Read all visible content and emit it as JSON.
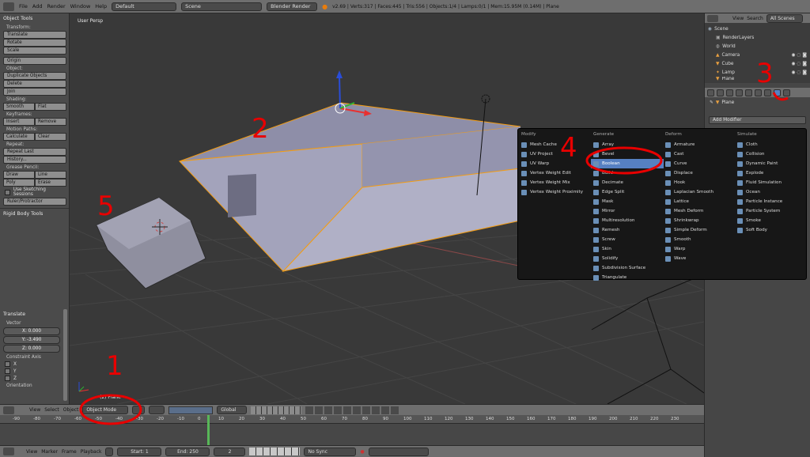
{
  "topbar": {
    "menus": [
      "File",
      "Add",
      "Render",
      "Window",
      "Help"
    ],
    "layout": "Default",
    "scene": "Scene",
    "engine": "Blender Render",
    "stats": "v2.69 | Verts:317 | Faces:445 | Tris:556 | Objects:1/4 | Lamps:0/1 | Mem:15.95M (0.14M) | Plane"
  },
  "left": {
    "title": "Object Tools",
    "transform_hdr": "Transform:",
    "transform": [
      "Translate",
      "Rotate",
      "Scale"
    ],
    "origin": "Origin",
    "object_hdr": "Object:",
    "object": [
      "Duplicate Objects",
      "Delete",
      "Join"
    ],
    "shading_hdr": "Shading:",
    "shading": [
      "Smooth",
      "Flat"
    ],
    "keyframes_hdr": "Keyframes:",
    "keyframes": [
      "Insert",
      "Remove"
    ],
    "motion_hdr": "Motion Paths:",
    "motion": [
      "Calculate",
      "Clear"
    ],
    "repeat_hdr": "Repeat:",
    "repeat": [
      "Repeat Last",
      "History..."
    ],
    "grease_hdr": "Grease Pencil:",
    "grease1": [
      "Draw",
      "Line"
    ],
    "grease2": [
      "Poly",
      "Erase"
    ],
    "sketch": "Use Sketching Sessions",
    "ruler": "Ruler/Protractor",
    "rigid": "Rigid Body Tools",
    "op_title": "Translate",
    "vector": "Vector",
    "x": "X: 0.000",
    "y": "Y: -3.490",
    "z": "Z: 0.000",
    "constraint": "Constraint Axis",
    "cx": "X",
    "cy": "Y",
    "cz": "Z",
    "orientation": "Orientation"
  },
  "viewport": {
    "label": "User Persp",
    "object_label": "(2) Plane"
  },
  "bottom": {
    "view": "View",
    "select": "Select",
    "object": "Object",
    "mode": "Object Mode",
    "orient": "Global"
  },
  "ruler": [
    "-90",
    "-80",
    "-70",
    "-60",
    "-50",
    "-40",
    "-30",
    "-20",
    "-10",
    "0",
    "10",
    "20",
    "30",
    "40",
    "50",
    "60",
    "70",
    "80",
    "90",
    "100",
    "110",
    "120",
    "130",
    "140",
    "150",
    "160",
    "170",
    "180",
    "190",
    "200",
    "210",
    "220",
    "230"
  ],
  "tlfooter": {
    "view": "View",
    "marker": "Marker",
    "frame": "Frame",
    "playback": "Playback",
    "start": "Start: 1",
    "end": "End: 250",
    "current": "2",
    "sync": "No Sync"
  },
  "outliner": {
    "view": "View",
    "search": "Search",
    "all": "All Scenes",
    "rows": [
      "Scene",
      "RenderLayers",
      "World",
      "Camera",
      "Cube",
      "Lamp",
      "Plane"
    ]
  },
  "props": {
    "object": "Plane",
    "add": "Add Modifier"
  },
  "popup": {
    "cols": [
      {
        "head": "Modify",
        "items": [
          "Mesh Cache",
          "UV Project",
          "UV Warp",
          "Vertex Weight Edit",
          "Vertex Weight Mix",
          "Vertex Weight Proximity"
        ]
      },
      {
        "head": "Generate",
        "items": [
          "Array",
          "Bevel",
          "Boolean",
          "Build",
          "Decimate",
          "Edge Split",
          "Mask",
          "Mirror",
          "Multiresolution",
          "Remesh",
          "Screw",
          "Skin",
          "Solidify",
          "Subdivision Surface",
          "Triangulate"
        ]
      },
      {
        "head": "Deform",
        "items": [
          "Armature",
          "Cast",
          "Curve",
          "Displace",
          "Hook",
          "Laplacian Smooth",
          "Lattice",
          "Mesh Deform",
          "Shrinkwrap",
          "Simple Deform",
          "Smooth",
          "Warp",
          "Wave"
        ]
      },
      {
        "head": "Simulate",
        "items": [
          "Cloth",
          "Collision",
          "Dynamic Paint",
          "Explode",
          "Fluid Simulation",
          "Ocean",
          "Particle Instance",
          "Particle System",
          "Smoke",
          "Soft Body"
        ]
      }
    ]
  },
  "annotations": [
    "1",
    "2",
    "3",
    "4",
    "5"
  ],
  "colors": {
    "accent": "#5680c2",
    "annotation": "#e80000",
    "selection": "#f39c12"
  }
}
